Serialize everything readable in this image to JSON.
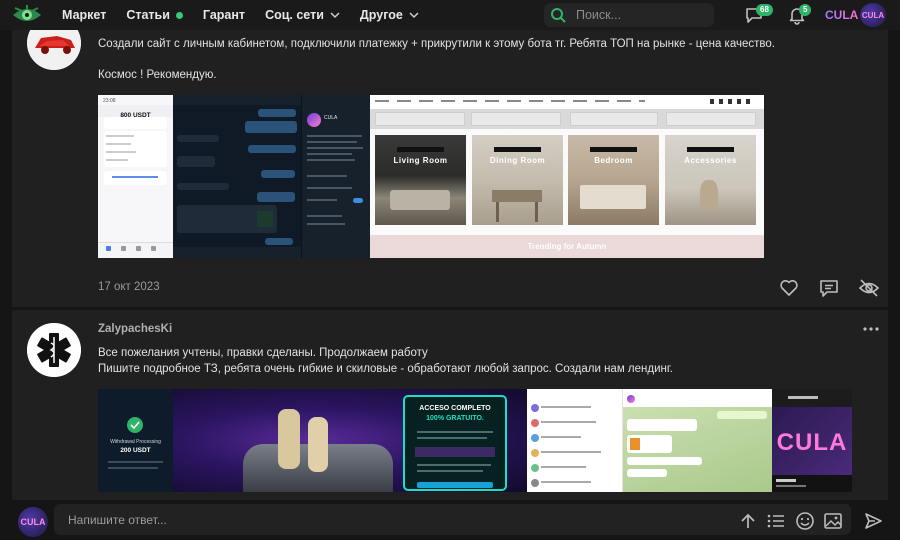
{
  "header": {
    "nav": [
      {
        "label": "Маркет"
      },
      {
        "label": "Статьи"
      },
      {
        "label": "Гарант"
      },
      {
        "label": "Соц. сети"
      },
      {
        "label": "Другое"
      }
    ],
    "search_placeholder": "Поиск...",
    "messages_count": "68",
    "notifications_count": "5",
    "brand": "CULA",
    "avatar_text": "CULA"
  },
  "post1": {
    "text_line1": "Создали сайт с личным кабинетом, подключили платежку + прикрутили к этому бота тг. Ребята ТОП на рынке - цена качество.",
    "text_line2": "Космос ! Рекомендую.",
    "date": "17 окт 2023",
    "phone_amount": "800 USDT",
    "shop_categories": [
      "Living Room",
      "Dining Room",
      "Bedroom",
      "Accessories"
    ],
    "shop_banner": "Trending for Autumn",
    "tg_channel": "CULA"
  },
  "post2": {
    "author": "ZalypachesKi",
    "text_line1": "Все пожелания учтены, правки сделаны. Продолжаем работу",
    "text_line2": "Пишите подробное ТЗ, ребята очень гибкие и скиловые - обработают любой запрос. Создали нам лендинг.",
    "withdrawal_title": "Withdrawal Processing",
    "withdrawal_amount": "200 USDT",
    "promo_title": "ACCESO COMPLETO",
    "promo_sub": "100% GRATUITO.",
    "logo_text": "CULA"
  },
  "reply": {
    "placeholder": "Напишите ответ...",
    "avatar_text": "CULA"
  },
  "colors": {
    "accent": "#2fb36a",
    "brand_gradient": "#a07bff",
    "background": "#151515",
    "card": "#202020"
  }
}
